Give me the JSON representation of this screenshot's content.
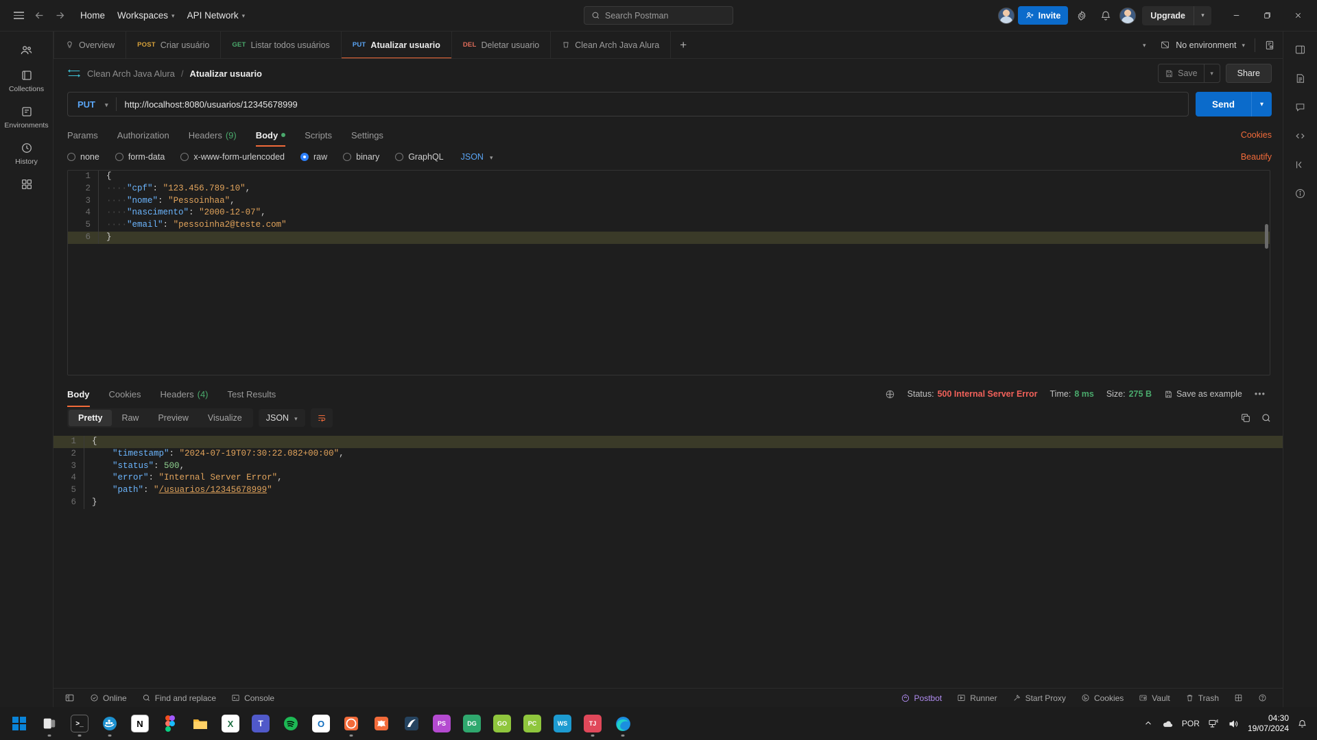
{
  "header": {
    "nav": [
      {
        "label": "Home",
        "caret": false
      },
      {
        "label": "Workspaces",
        "caret": true
      },
      {
        "label": "API Network",
        "caret": true
      }
    ],
    "search_placeholder": "Search Postman",
    "invite_label": "Invite",
    "upgrade_label": "Upgrade",
    "icons": {
      "hamburger": "hamburger-icon",
      "back": "back-arrow-icon",
      "forward": "forward-arrow-icon",
      "search": "search-icon",
      "settings": "gear-icon",
      "notifications": "bell-icon",
      "minimize": "minimize-icon",
      "maximize": "maximize-icon",
      "close": "close-icon"
    }
  },
  "rail": {
    "items": [
      {
        "label": "",
        "icon": "collections-people-icon"
      },
      {
        "label": "Collections",
        "icon": "collections-icon"
      },
      {
        "label": "Environments",
        "icon": "environments-icon"
      },
      {
        "label": "History",
        "icon": "history-icon"
      },
      {
        "label": "",
        "icon": "apps-grid-icon"
      }
    ]
  },
  "right_rail": {
    "items": [
      {
        "icon": "sidebar-panel-icon"
      },
      {
        "icon": "documentation-icon"
      },
      {
        "icon": "comments-icon"
      },
      {
        "icon": "code-snippet-icon"
      },
      {
        "icon": "collapse-icon"
      },
      {
        "icon": "info-icon"
      }
    ]
  },
  "tabstrip": {
    "tabs": [
      {
        "method": "",
        "label": "Overview",
        "icon": "overview-icon",
        "active": false,
        "method_color": ""
      },
      {
        "method": "POST",
        "label": "Criar usuário",
        "active": false,
        "method_color": "#d8a23a"
      },
      {
        "method": "GET",
        "label": "Listar todos usuários",
        "active": false,
        "method_color": "#4aa96c"
      },
      {
        "method": "PUT",
        "label": "Atualizar usuario",
        "active": true,
        "method_color": "#5aa5f5"
      },
      {
        "method": "DEL",
        "label": "Deletar usuario",
        "active": false,
        "method_color": "#e06c5a"
      },
      {
        "method": "",
        "label": "Clean Arch Java Alura",
        "icon": "collection-icon",
        "active": false,
        "method_color": ""
      }
    ],
    "add_label": "+",
    "environment_label": "No environment",
    "env_icon": "no-environment-icon",
    "env_manage_icon": "environment-quick-look-icon",
    "overflow_icon": "chevron-down-icon"
  },
  "breadcrumb": {
    "http_badge": "HTTP",
    "parent": "Clean Arch Java Alura",
    "separator": "/",
    "current": "Atualizar usuario",
    "save_label": "Save",
    "share_label": "Share",
    "save_icon": "save-disk-icon"
  },
  "request": {
    "method": "PUT",
    "url": "http://localhost:8080/usuarios/12345678999",
    "send_label": "Send",
    "tabs": [
      {
        "label": "Params",
        "count": "",
        "active": false,
        "dot": false
      },
      {
        "label": "Authorization",
        "count": "",
        "active": false,
        "dot": false
      },
      {
        "label": "Headers",
        "count": "(9)",
        "active": false,
        "dot": false
      },
      {
        "label": "Body",
        "count": "",
        "active": true,
        "dot": true
      },
      {
        "label": "Scripts",
        "count": "",
        "active": false,
        "dot": false
      },
      {
        "label": "Settings",
        "count": "",
        "active": false,
        "dot": false
      }
    ],
    "cookies_label": "Cookies",
    "body_modes": [
      {
        "label": "none",
        "selected": false
      },
      {
        "label": "form-data",
        "selected": false
      },
      {
        "label": "x-www-form-urlencoded",
        "selected": false
      },
      {
        "label": "raw",
        "selected": true
      },
      {
        "label": "binary",
        "selected": false
      },
      {
        "label": "GraphQL",
        "selected": false
      }
    ],
    "format": "JSON",
    "beautify_label": "Beautify",
    "body_lines": [
      {
        "num": "1",
        "highlight": false,
        "tokens": [
          {
            "t": "{",
            "c": "p"
          }
        ]
      },
      {
        "num": "2",
        "highlight": false,
        "tokens": [
          {
            "t": "····",
            "c": "ws"
          },
          {
            "t": "\"cpf\"",
            "c": "k"
          },
          {
            "t": ":",
            "c": "p"
          },
          {
            "t": " ",
            "c": "ws"
          },
          {
            "t": "\"123.456.789-10\"",
            "c": "s"
          },
          {
            "t": ",",
            "c": "p"
          }
        ]
      },
      {
        "num": "3",
        "highlight": false,
        "tokens": [
          {
            "t": "····",
            "c": "ws"
          },
          {
            "t": "\"nome\"",
            "c": "k"
          },
          {
            "t": ":",
            "c": "p"
          },
          {
            "t": " ",
            "c": "ws"
          },
          {
            "t": "\"Pessoinhaa\"",
            "c": "s"
          },
          {
            "t": ",",
            "c": "p"
          }
        ]
      },
      {
        "num": "4",
        "highlight": false,
        "tokens": [
          {
            "t": "····",
            "c": "ws"
          },
          {
            "t": "\"nascimento\"",
            "c": "k"
          },
          {
            "t": ":",
            "c": "p"
          },
          {
            "t": " ",
            "c": "ws"
          },
          {
            "t": "\"2000-12-07\"",
            "c": "s"
          },
          {
            "t": ",",
            "c": "p"
          }
        ]
      },
      {
        "num": "5",
        "highlight": false,
        "tokens": [
          {
            "t": "····",
            "c": "ws"
          },
          {
            "t": "\"email\"",
            "c": "k"
          },
          {
            "t": ":",
            "c": "p"
          },
          {
            "t": " ",
            "c": "ws"
          },
          {
            "t": "\"pessoinha2@teste.com\"",
            "c": "s"
          }
        ]
      },
      {
        "num": "6",
        "highlight": true,
        "tokens": [
          {
            "t": "}",
            "c": "p"
          }
        ]
      }
    ]
  },
  "response": {
    "tabs": [
      {
        "label": "Body",
        "count": "",
        "active": true
      },
      {
        "label": "Cookies",
        "count": "",
        "active": false
      },
      {
        "label": "Headers",
        "count": "(4)",
        "active": false
      },
      {
        "label": "Test Results",
        "count": "",
        "active": false
      }
    ],
    "status_label": "Status:",
    "status_value": "500 Internal Server Error",
    "time_label": "Time:",
    "time_value": "8 ms",
    "size_label": "Size:",
    "size_value": "275 B",
    "save_example_label": "Save as example",
    "more_icon": "more-options-icon",
    "globe_icon": "globe-icon",
    "views": [
      {
        "label": "Pretty",
        "active": true
      },
      {
        "label": "Raw",
        "active": false
      },
      {
        "label": "Preview",
        "active": false
      },
      {
        "label": "Visualize",
        "active": false
      }
    ],
    "format": "JSON",
    "wrap_icon": "word-wrap-icon",
    "copy_icon": "copy-icon",
    "search_icon": "search-icon",
    "body_lines": [
      {
        "num": "1",
        "highlight": true,
        "tokens": [
          {
            "t": "{",
            "c": "p"
          }
        ]
      },
      {
        "num": "2",
        "highlight": false,
        "tokens": [
          {
            "t": "    ",
            "c": "ws"
          },
          {
            "t": "\"timestamp\"",
            "c": "k"
          },
          {
            "t": ": ",
            "c": "p"
          },
          {
            "t": "\"2024-07-19T07:30:22.082+00:00\"",
            "c": "s"
          },
          {
            "t": ",",
            "c": "p"
          }
        ]
      },
      {
        "num": "3",
        "highlight": false,
        "tokens": [
          {
            "t": "    ",
            "c": "ws"
          },
          {
            "t": "\"status\"",
            "c": "k"
          },
          {
            "t": ": ",
            "c": "p"
          },
          {
            "t": "500",
            "c": "n"
          },
          {
            "t": ",",
            "c": "p"
          }
        ]
      },
      {
        "num": "4",
        "highlight": false,
        "tokens": [
          {
            "t": "    ",
            "c": "ws"
          },
          {
            "t": "\"error\"",
            "c": "k"
          },
          {
            "t": ": ",
            "c": "p"
          },
          {
            "t": "\"Internal Server Error\"",
            "c": "s"
          },
          {
            "t": ",",
            "c": "p"
          }
        ]
      },
      {
        "num": "5",
        "highlight": false,
        "tokens": [
          {
            "t": "    ",
            "c": "ws"
          },
          {
            "t": "\"path\"",
            "c": "k"
          },
          {
            "t": ": ",
            "c": "p"
          },
          {
            "t": "\"",
            "c": "s"
          },
          {
            "t": "/usuarios/12345678999",
            "c": "s u"
          },
          {
            "t": "\"",
            "c": "s"
          }
        ]
      },
      {
        "num": "6",
        "highlight": false,
        "tokens": [
          {
            "t": "}",
            "c": "p"
          }
        ]
      }
    ]
  },
  "statusbar": {
    "left": [
      {
        "label": "",
        "icon": "toggle-sidebar-icon"
      },
      {
        "label": "Online",
        "icon": "online-check-icon"
      },
      {
        "label": "Find and replace",
        "icon": "search-icon"
      },
      {
        "label": "Console",
        "icon": "console-icon"
      }
    ],
    "right": [
      {
        "label": "Postbot",
        "icon": "postbot-icon"
      },
      {
        "label": "Runner",
        "icon": "runner-icon"
      },
      {
        "label": "Start Proxy",
        "icon": "proxy-icon"
      },
      {
        "label": "Cookies",
        "icon": "cookies-icon"
      },
      {
        "label": "Vault",
        "icon": "vault-icon"
      },
      {
        "label": "Trash",
        "icon": "trash-icon"
      },
      {
        "label": "",
        "icon": "layout-icon"
      },
      {
        "label": "",
        "icon": "help-icon"
      }
    ]
  },
  "taskbar": {
    "apps": [
      {
        "name": "start-windows",
        "glyph": "",
        "color": "#0a84d8",
        "running": false
      },
      {
        "name": "task-view",
        "glyph": "",
        "color": "#9aa0a6",
        "running": true
      },
      {
        "name": "terminal",
        "glyph": ">_",
        "color": "#2b2b2b",
        "running": true
      },
      {
        "name": "docker",
        "glyph": "",
        "color": "#1d91d0",
        "running": true
      },
      {
        "name": "notion",
        "glyph": "N",
        "color": "#ffffff",
        "running": false
      },
      {
        "name": "figma",
        "glyph": "",
        "color": "#e64b3c",
        "running": false
      },
      {
        "name": "file-explorer",
        "glyph": "",
        "color": "#f7b733",
        "running": false
      },
      {
        "name": "excel",
        "glyph": "X",
        "color": "#1d6f42",
        "running": false
      },
      {
        "name": "teams",
        "glyph": "T",
        "color": "#5059c9",
        "running": false
      },
      {
        "name": "spotify",
        "glyph": "",
        "color": "#1db954",
        "running": false
      },
      {
        "name": "outlook",
        "glyph": "O",
        "color": "#0f6cbd",
        "running": false
      },
      {
        "name": "postman",
        "glyph": "",
        "color": "#f26b3a",
        "running": true
      },
      {
        "name": "obsidian",
        "glyph": "",
        "color": "#f26b3a",
        "running": false
      },
      {
        "name": "editor",
        "glyph": "",
        "color": "#2e5c8a",
        "running": false
      },
      {
        "name": "ps-course",
        "glyph": "PS",
        "color": "#b44ad0",
        "running": false
      },
      {
        "name": "dg-course",
        "glyph": "DG",
        "color": "#2fa86e",
        "running": false
      },
      {
        "name": "go-course",
        "glyph": "GO",
        "color": "#8fc63d",
        "running": false
      },
      {
        "name": "pc-course",
        "glyph": "PC",
        "color": "#8fc63d",
        "running": false
      },
      {
        "name": "ws-course",
        "glyph": "WS",
        "color": "#1d9bd1",
        "running": false
      },
      {
        "name": "tj-course",
        "glyph": "TJ",
        "color": "#e0485a",
        "running": true
      },
      {
        "name": "edge",
        "glyph": "",
        "color": "#1b8fe0",
        "running": true
      }
    ],
    "tray": {
      "overflow_icon": "chevron-up-icon",
      "onedrive_icon": "onedrive-icon",
      "language": "POR",
      "network_icon": "network-icon",
      "volume_icon": "volume-icon",
      "time": "04:30",
      "date": "19/07/2024",
      "notification_icon": "bell-icon"
    }
  },
  "colors": {
    "accent_orange": "#f26b3a",
    "accent_blue": "#0b6bcb",
    "error_red": "#f1615a",
    "success_green": "#4aa96c",
    "bg": "#1e1e1e"
  }
}
